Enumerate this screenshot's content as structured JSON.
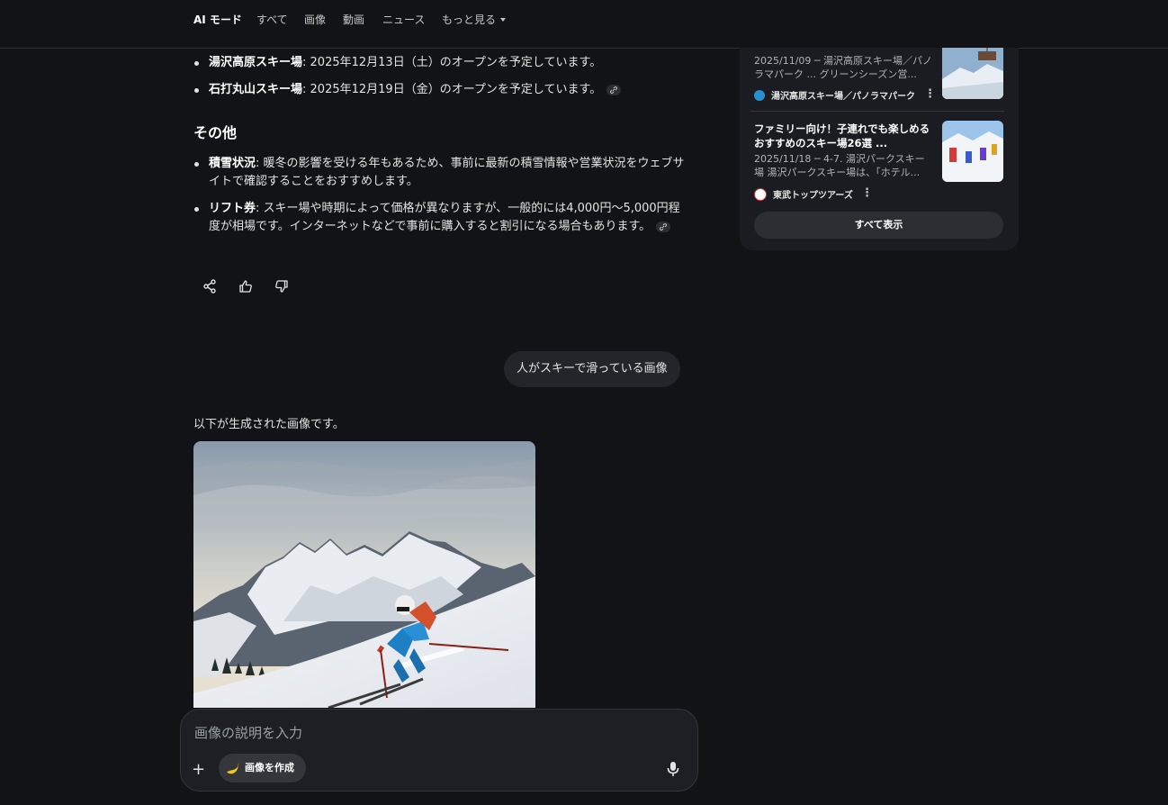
{
  "nav": {
    "tabs": [
      "AI モード",
      "すべて",
      "画像",
      "動画",
      "ニュース",
      "もっと見る"
    ],
    "active_tab": "AI モード"
  },
  "answer": {
    "bullets_top": [
      {
        "bold": "湯沢高原スキー場",
        "text": ": 2025年12月13日（土）のオープンを予定しています。"
      },
      {
        "bold": "石打丸山スキー場",
        "text": ": 2025年12月19日（金）のオープンを予定しています。"
      }
    ],
    "heading_other": "その他",
    "bullets_other": [
      {
        "bold": "積雪状況",
        "text": ": 暖冬の影響を受ける年もあるため、事前に最新の積雪情報や営業状況をウェブサイトで確認することをおすすめします。"
      },
      {
        "bold": "リフト券",
        "text": ": スキー場や時期によって価格が異なりますが、一般的には4,000円〜5,000円程度が相場です。インターネットなどで事前に購入すると割引になる場合もあります。"
      }
    ]
  },
  "actions": [
    "share-icon",
    "thumbs-up-icon",
    "thumbs-down-icon"
  ],
  "user_message": "人がスキーで滑っている画像",
  "generated_label": "以下が生成された画像です。",
  "input": {
    "placeholder": "画像の説明を入力",
    "create_chip": "画像を作成",
    "plus": "+"
  },
  "sidebar": {
    "cards": [
      {
        "title": "",
        "snippet": "2025/11/09 ─ 湯沢高原スキー場／パノラマパーク ... グリーンシーズン営...",
        "source": "湯沢高原スキー場／パノラマパーク"
      },
      {
        "title": "ファミリー向け！子連れでも楽しめるおすすめのスキー場26選 ...",
        "snippet": "2025/11/18 ─ 4-7. 湯沢パークスキー場 湯沢パークスキー場は、「ホテル...",
        "source": "東武トップツアーズ"
      }
    ],
    "show_all": "すべて表示"
  },
  "colors": {
    "background": "#121317",
    "panel": "#1b1c21",
    "bubble": "#23252b",
    "text": "#e3e3e3",
    "muted": "#9aa0a6"
  }
}
